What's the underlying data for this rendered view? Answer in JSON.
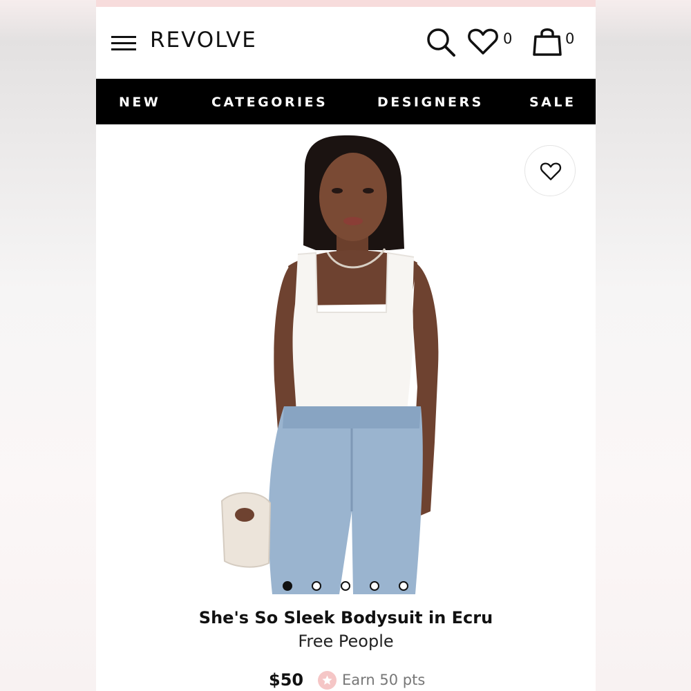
{
  "header": {
    "logo": "REVOLVE",
    "wishlist_count": "0",
    "bag_count": "0"
  },
  "nav": {
    "items": [
      "NEW",
      "CATEGORIES",
      "DESIGNERS",
      "SALE"
    ]
  },
  "product": {
    "title": "She's So Sleek Bodysuit in Ecru",
    "brand": "Free People",
    "price": "$50",
    "points": "Earn 50 pts",
    "image_count": 5,
    "active_image": 1
  },
  "colors": {
    "nav_bg": "#000000",
    "nav_text": "#ffffff",
    "points_icon": "#f5c6c6"
  },
  "icons": [
    "menu-icon",
    "search-icon",
    "heart-icon",
    "bag-icon",
    "star-icon"
  ]
}
